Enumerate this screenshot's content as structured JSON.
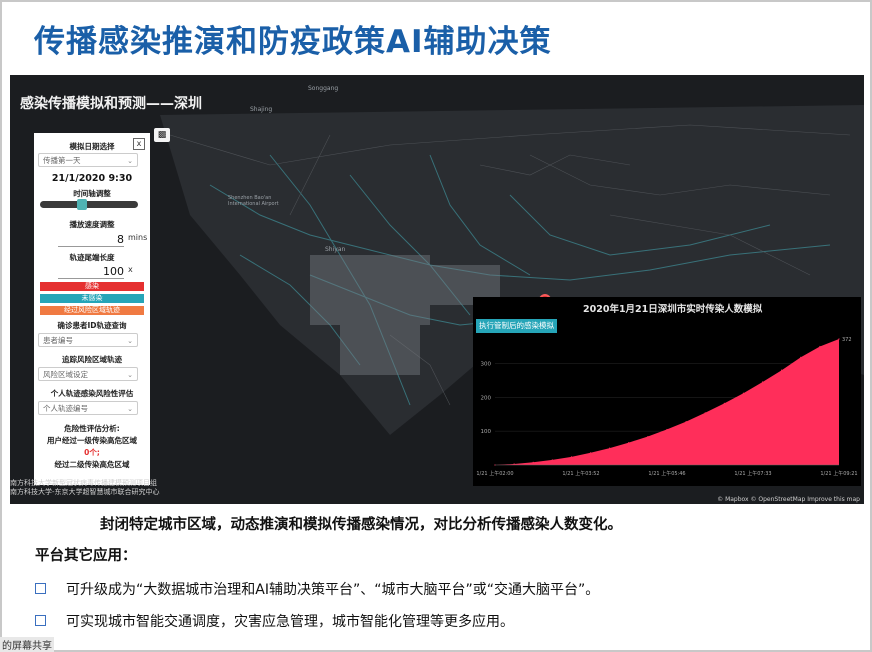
{
  "slide": {
    "title": "传播感染推演和防疫政策AI辅助决策"
  },
  "map": {
    "title": "感染传播模拟和预测——深圳",
    "place_labels": [
      {
        "text": "Shajing"
      },
      {
        "text": "Songgang"
      },
      {
        "text": "Shiyan"
      },
      {
        "text": "Shenzhen Bao'an International Airport"
      }
    ],
    "credits": [
      "南方科技大学新型冠状病毒传播建模预测项目组",
      "南方科技大学-东京大学超智慧城市联合研究中心"
    ],
    "attribution": "© Mapbox © OpenStreetMap  Improve this map"
  },
  "panel": {
    "close_label": "x",
    "toggle_icon": "camera-icon",
    "date_select_label": "模拟日期选择",
    "date_select_value": "传播第一天",
    "datetime": "21/1/2020 9:30",
    "time_axis_label": "时间轴调整",
    "time_axis_fraction": 0.42,
    "speed_label": "播放速度调整",
    "speed_value": "8",
    "speed_unit": "mins",
    "trail_label": "轨迹尾端长度",
    "trail_value": "100",
    "trail_unit": "x",
    "legend": [
      {
        "label": "感染",
        "color": "#e53030"
      },
      {
        "label": "未感染",
        "color": "#26a5b8"
      },
      {
        "label": "经过风险区域轨迹",
        "color": "#f07a42"
      }
    ],
    "patient_query_label": "确诊患者ID轨迹查询",
    "patient_placeholder": "患者编号",
    "risk_track_label": "追踪风险区域轨迹",
    "risk_area_placeholder": "风险区域设定",
    "personal_risk_label": "个人轨迹感染风险性评估",
    "personal_placeholder": "个人轨迹编号",
    "risk_analysis_label": "危险性评估分析:",
    "first_level_label": "用户经过一级传染高危区域",
    "first_level_value": "0个;",
    "second_level_label": "经过二级传染高危区域"
  },
  "chart": {
    "tag_label": "执行管制后的感染模拟",
    "title": "2020年1月21日深圳市实时传染人数模拟"
  },
  "chart_data": {
    "type": "area",
    "title": "2020年1月21日深圳市实时传染人数模拟",
    "color": "#ff2e5a",
    "x": [
      "1/21 上午02:00",
      "1/21 上午03:52",
      "1/21 上午05:46",
      "1/21 上午07:33",
      "1/21 上午09:21"
    ],
    "x_ticks": [
      "1/21 上午02:00",
      "1/21 上午03:52",
      "1/21 上午05:46",
      "1/21 上午07:33",
      "1/21 上午09:21"
    ],
    "y_ticks": [
      100,
      200,
      300
    ],
    "ylim": [
      0,
      372
    ],
    "max_label": "372",
    "values": [
      0,
      3,
      8,
      15,
      24,
      36,
      50,
      66,
      84,
      105,
      128,
      154,
      182,
      212,
      245,
      280,
      318,
      350,
      372
    ]
  },
  "caption": "封闭特定城市区域，动态推演和模拟传播感染情况，对比分析传播感染人数变化。",
  "subhead": "平台其它应用：",
  "bullets": [
    "可升级成为“大数据城市治理和AI辅助决策平台”、“城市大脑平台”或“交通大脑平台”。",
    "可实现城市智能交通调度，灾害应急管理，城市智能化管理等更多应用。"
  ],
  "footer_tag": "的屏幕共享"
}
